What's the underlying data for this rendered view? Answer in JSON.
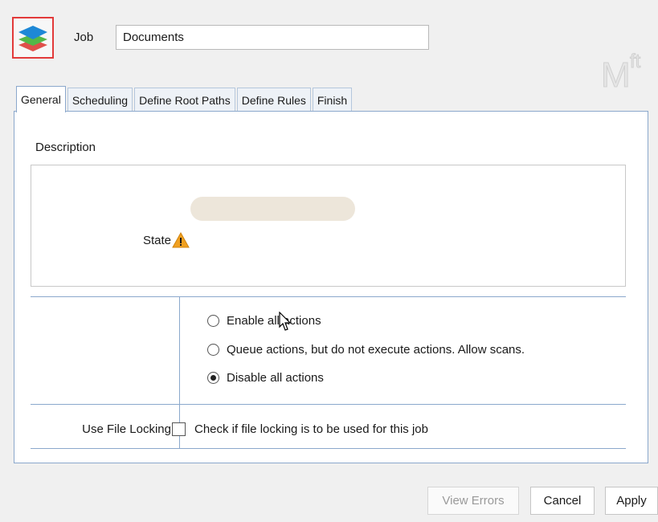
{
  "header": {
    "job_label": "Job",
    "job_value": "Documents",
    "logo_text": "Mft"
  },
  "tabs": [
    {
      "label": "General",
      "active": true
    },
    {
      "label": "Scheduling",
      "active": false
    },
    {
      "label": "Define Root Paths",
      "active": false
    },
    {
      "label": "Define Rules",
      "active": false
    },
    {
      "label": "Finish",
      "active": false
    }
  ],
  "general": {
    "description_label": "Description",
    "description_value": "",
    "state_label": "State",
    "state_options": [
      {
        "label": "Enable all actions",
        "selected": false
      },
      {
        "label": "Queue actions, but do not execute actions. Allow scans.",
        "selected": false
      },
      {
        "label": "Disable all actions",
        "selected": true
      }
    ],
    "locking_label": "Use File Locking",
    "locking_checkbox_label": "Check if file locking is to be used for this job",
    "locking_checked": false
  },
  "buttons": {
    "view_errors": "View Errors",
    "cancel": "Cancel",
    "apply": "Apply"
  },
  "colors": {
    "accent_border": "#8ba8cc",
    "warning": "#f0a020",
    "icon_highlight": "#e23a3a"
  },
  "icons": {
    "app": "layers-icon",
    "state_warning": "warning-icon"
  }
}
